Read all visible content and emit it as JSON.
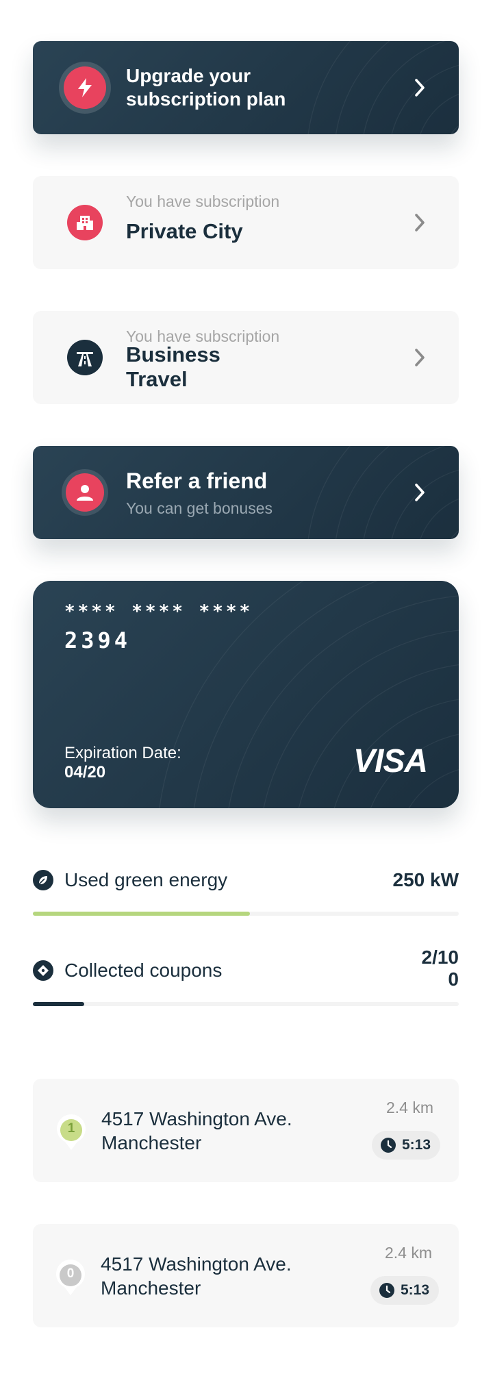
{
  "cards": {
    "upgrade": {
      "title_line1": "Upgrade your",
      "title_line2": "subscription plan"
    },
    "private_city": {
      "subtitle": "You have subscription",
      "title": "Private City"
    },
    "business_travel": {
      "subtitle": "You have subscription",
      "title_line1": "Business",
      "title_line2": "Travel"
    },
    "refer": {
      "title": "Refer a friend",
      "subtitle": "You can get bonuses"
    }
  },
  "payment_card": {
    "masked": "**** **** ****",
    "last_digits": "2394",
    "expiration_label": "Expiration Date:",
    "expiration_value": "04/20",
    "brand": "VISA"
  },
  "stats": {
    "energy": {
      "label": "Used green energy",
      "value": "250 kW",
      "progress": 0.51,
      "color": "#b5d67e"
    },
    "coupons": {
      "label": "Collected coupons",
      "value_line1": "2/10",
      "value_line2": "0",
      "progress": 0.12,
      "color": "#1b2f3d"
    }
  },
  "routes": [
    {
      "pin": "1",
      "address_line1": "4517 Washington Ave.",
      "address_line2": "Manchester",
      "distance": "2.4 km",
      "time": "5:13",
      "pin_color": "#c8dc88"
    },
    {
      "pin": "0",
      "address_line1": "4517 Washington Ave.",
      "address_line2": "Manchester",
      "distance": "2.4 km",
      "time": "5:13",
      "pin_color": "#c9c9c9"
    }
  ],
  "colors": {
    "accent": "#e8435e",
    "dark": "#1b2f3d",
    "green": "#b5d67e"
  },
  "icons": {
    "upgrade": "lightning-icon",
    "private_city": "building-icon",
    "business_travel": "road-icon",
    "refer": "user-icon",
    "energy": "leaf-icon",
    "coupons": "ticket-icon",
    "time": "clock-icon"
  }
}
